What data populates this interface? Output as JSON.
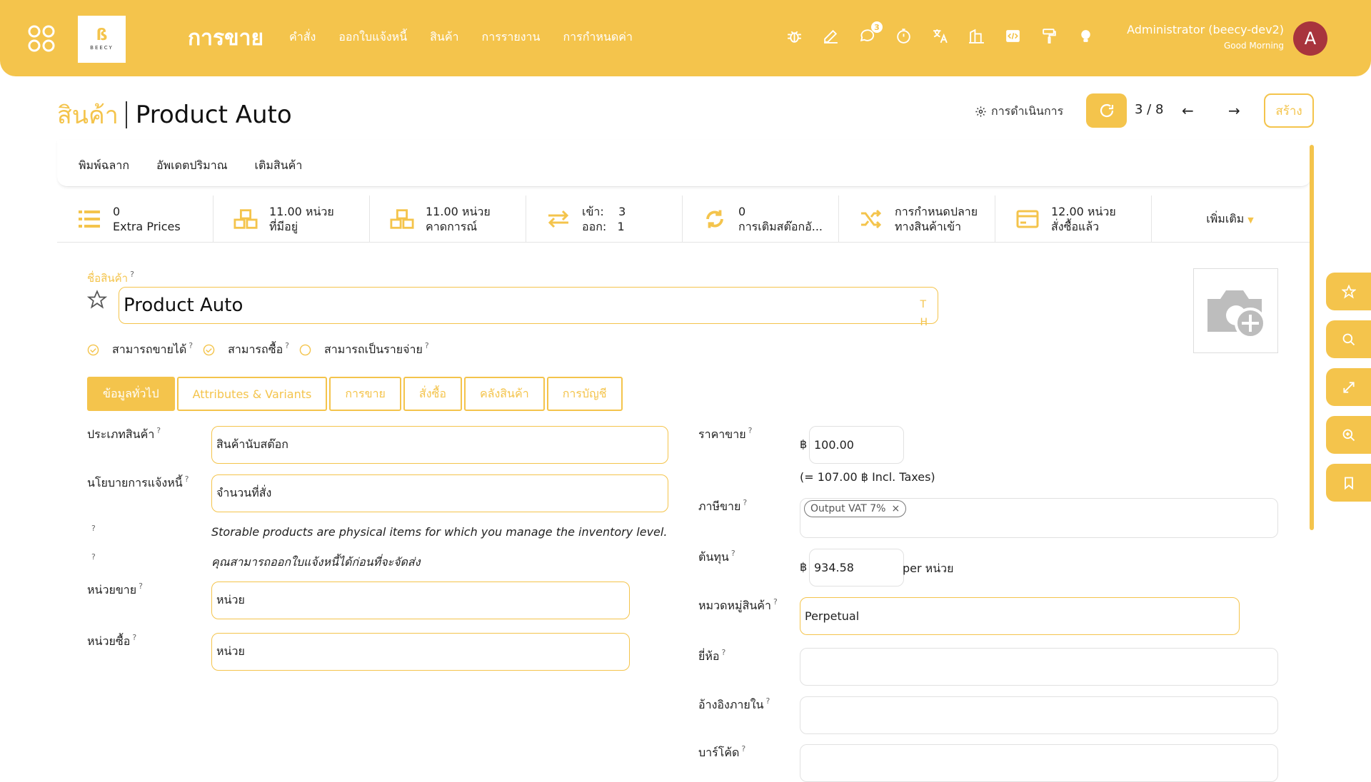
{
  "topbar": {
    "brand": "การขาย",
    "logo_text": "BEECY",
    "menu": [
      "คำสั่ง",
      "ออกใบแจ้งหนี้",
      "สินค้า",
      "การรายงาน",
      "การกำหนดค่า"
    ],
    "message_badge": "3",
    "user_name": "Administrator (beecy-dev2)",
    "greeting": "Good Morning",
    "avatar_letter": "A"
  },
  "control": {
    "parent": "สินค้า",
    "current": "Product Auto",
    "actions_label": "การดำเนินการ",
    "pager": "3 / 8",
    "create_label": "สร้าง"
  },
  "statusbar": {
    "buttons": [
      "พิมพ์ฉลาก",
      "อัพเดตปริมาณ",
      "เติมสินค้า"
    ]
  },
  "stats": [
    {
      "line1": "0",
      "line2": "Extra Prices",
      "icon": "list-icon"
    },
    {
      "line1": "11.00 หน่วย",
      "line2": "ที่มีอยู่",
      "icon": "cubes-icon"
    },
    {
      "line1": "11.00 หน่วย",
      "line2": "คาดการณ์",
      "icon": "cubes-icon"
    },
    {
      "line1": "เข้า:    3",
      "line2": "ออก:   1",
      "icon": "exchange-icon"
    },
    {
      "line1": "0",
      "line2": "การเติมสต๊อกอั...",
      "icon": "refresh-icon"
    },
    {
      "line1": "การกำหนดปลาย",
      "line2": "ทางสินค้าเข้า",
      "icon": "random-icon"
    },
    {
      "line1": "12.00 หน่วย",
      "line2": "สั่งซื้อแล้ว",
      "icon": "credit-card-icon"
    }
  ],
  "stat_more": "เพิ่มเติม",
  "product": {
    "name_label": "ชื่อสินค้า",
    "name": "Product Auto",
    "lang_tag": "T\nH",
    "can_sell_label": "สามารถขายได้",
    "can_buy_label": "สามารถซื้อ",
    "can_expense_label": "สามารถเป็นรายจ่าย"
  },
  "tabs": [
    "ข้อมูลทั่วไป",
    "Attributes & Variants",
    "การขาย",
    "สั่งซื้อ",
    "คลังสินค้า",
    "การบัญชี"
  ],
  "left": {
    "type_label": "ประเภทสินค้า",
    "type_value": "สินค้านับสต๊อก",
    "invoice_label": "นโยบายการแจ้งหนี้",
    "invoice_value": "จำนวนที่สั่ง",
    "help1": "Storable products are physical items for which you manage the inventory level.",
    "help2": "คุณสามารถออกใบแจ้งหนี้ได้ก่อนที่จะจัดส่ง",
    "sale_uom_label": "หน่วยขาย",
    "sale_uom_value": "หน่วย",
    "purchase_uom_label": "หน่วยซื้อ",
    "purchase_uom_value": "หน่วย"
  },
  "right": {
    "price_label": "ราคาขาย",
    "currency": "฿",
    "price_value": "100.00",
    "price_incl": "(= 107.00 ฿ Incl. Taxes)",
    "tax_label": "ภาษีขาย",
    "tax_tag": "Output VAT 7%",
    "cost_label": "ต้นทุน",
    "cost_value": "934.58",
    "cost_unit": "per หน่วย",
    "category_label": "หมวดหมู่สินค้า",
    "category_value": "Perpetual",
    "brand_label": "ยี่ห้อ",
    "ref_label": "อ้างอิงภายใน",
    "barcode_label": "บาร์โค้ด"
  },
  "colors": {
    "accent": "#f4c44c",
    "avatar": "#a8343d"
  }
}
